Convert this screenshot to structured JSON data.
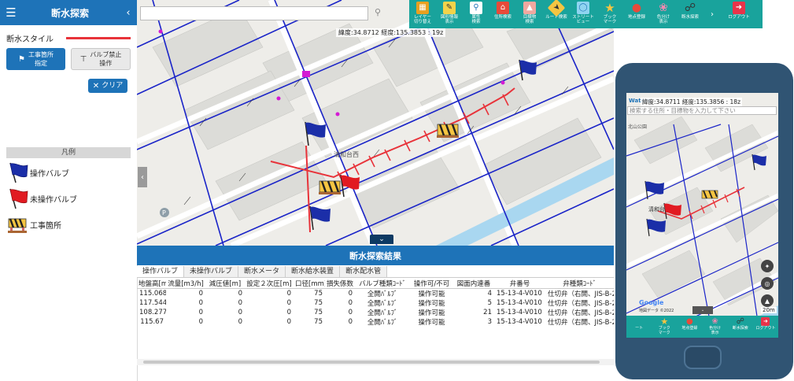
{
  "left_panel": {
    "title": "断水探索",
    "style_label": "断水スタイル",
    "style_color": "#e8333a",
    "construction_button": "工事箇所\n指定",
    "valve_prohibit_button": "バルブ禁止\n操作",
    "clear_button": "クリア",
    "legend_title": "凡例",
    "legend": [
      {
        "label": "操作バルブ",
        "icon": "blue-flag-icon",
        "color": "#1b2ea8"
      },
      {
        "label": "未操作バルブ",
        "icon": "red-flag-icon",
        "color": "#e11b22"
      },
      {
        "label": "工事箇所",
        "icon": "construction-barrier-icon",
        "color": "#f5a623"
      }
    ]
  },
  "map": {
    "coords": "緯度:34.8712 経度:135.3853 : 19z",
    "place_label": "清和台西",
    "accent_water": "#a9d7f0",
    "pipe_color": "#1a24c8",
    "cut_color": "#e8333a"
  },
  "toolbar": [
    {
      "label": "レイヤー\n切り替え",
      "icon": "layers-icon"
    },
    {
      "label": "図形情報\n表示",
      "icon": "note-icon"
    },
    {
      "label": "属性\n検索",
      "icon": "magnifier-icon"
    },
    {
      "label": "住所検索",
      "icon": "house-icon"
    },
    {
      "label": "目標物\n検索",
      "icon": "landmark-icon"
    },
    {
      "label": "ルート検索",
      "icon": "route-sign-icon"
    },
    {
      "label": "ストリート\nビュー",
      "icon": "streetview-icon"
    },
    {
      "label": "ブック\nマーク",
      "icon": "star-icon"
    },
    {
      "label": "地点登録",
      "icon": "pin-icon"
    },
    {
      "label": "色分け\n表示",
      "icon": "pinwheel-icon"
    },
    {
      "label": "断水探索",
      "icon": "valve-icon"
    },
    {
      "label": "",
      "icon": "chevron-right-icon"
    },
    {
      "label": "ログアウト",
      "icon": "logout-icon"
    }
  ],
  "results": {
    "title": "断水探索結果",
    "tabs": [
      "操作バルブ",
      "未操作バルブ",
      "断水メータ",
      "断水給水装置",
      "断水配水管"
    ],
    "columns": [
      "地盤高[m]",
      "流量[m3/h]",
      "減圧値[m]",
      "設定２次圧[m]",
      "口径[mm]",
      "損失係数",
      "バルブ種類ｺｰﾄﾞ",
      "操作可/不可",
      "図面内連番",
      "弁番号",
      "弁種類ｺｰﾄﾞ"
    ],
    "rows": [
      [
        "115.068",
        "0",
        "0",
        "0",
        "75",
        "0",
        "全開ﾊﾞﾙﾌﾞ",
        "操作可能",
        "4",
        "15-13-4-V010",
        "仕切弁（右開、JIS-B-2062"
      ],
      [
        "117.544",
        "0",
        "0",
        "0",
        "75",
        "0",
        "全開ﾊﾞﾙﾌﾞ",
        "操作可能",
        "5",
        "15-13-4-V010",
        "仕切弁（右開、JIS-B-2062"
      ],
      [
        "108.277",
        "0",
        "0",
        "0",
        "75",
        "0",
        "全開ﾊﾞﾙﾌﾞ",
        "操作可能",
        "21",
        "15-13-4-V010",
        "仕切弁（右開、JIS-B-2062"
      ],
      [
        "115.67",
        "0",
        "0",
        "0",
        "75",
        "0",
        "全開ﾊﾞﾙﾌﾞ",
        "操作可能",
        "3",
        "15-13-4-V010",
        "仕切弁（右開、JIS-B-2062"
      ]
    ]
  },
  "phone": {
    "logo": "Waters",
    "coords": "緯度:34.8711 経度:135.3856 : 18z",
    "search_placeholder": "検索する住所・目標物を入力して下さい",
    "place_label": "清和台",
    "google": "Google",
    "attribution": "地図データ ©2022",
    "scale": "20m",
    "toolbar": [
      {
        "label": "ート",
        "icon": "route-icon"
      },
      {
        "label": "ブック\nマーク",
        "icon": "star-icon"
      },
      {
        "label": "地点登録",
        "icon": "pin-icon"
      },
      {
        "label": "色分け\n表示",
        "icon": "pinwheel-icon"
      },
      {
        "label": "断水探索",
        "icon": "valve-icon"
      },
      {
        "label": "ログアウト",
        "icon": "logout-icon"
      }
    ]
  }
}
